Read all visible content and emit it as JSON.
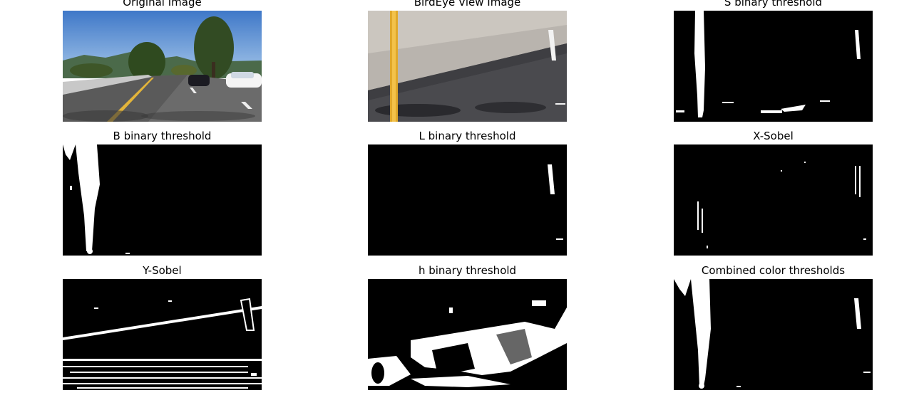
{
  "figure": {
    "panels": [
      {
        "id": "original",
        "title": "Original Image",
        "kind": "photo-road"
      },
      {
        "id": "birdeye",
        "title": "BirdEye View Image",
        "kind": "photo-birdeye"
      },
      {
        "id": "s-binary",
        "title": "S binary threshold",
        "kind": "binary"
      },
      {
        "id": "b-binary",
        "title": "B binary threshold",
        "kind": "binary"
      },
      {
        "id": "l-binary",
        "title": "L binary threshold",
        "kind": "binary"
      },
      {
        "id": "x-sobel",
        "title": "X-Sobel",
        "kind": "binary"
      },
      {
        "id": "y-sobel",
        "title": "Y-Sobel",
        "kind": "binary"
      },
      {
        "id": "h-binary",
        "title": "h binary threshold",
        "kind": "binary"
      },
      {
        "id": "combined",
        "title": "Combined color thresholds",
        "kind": "binary"
      }
    ]
  }
}
